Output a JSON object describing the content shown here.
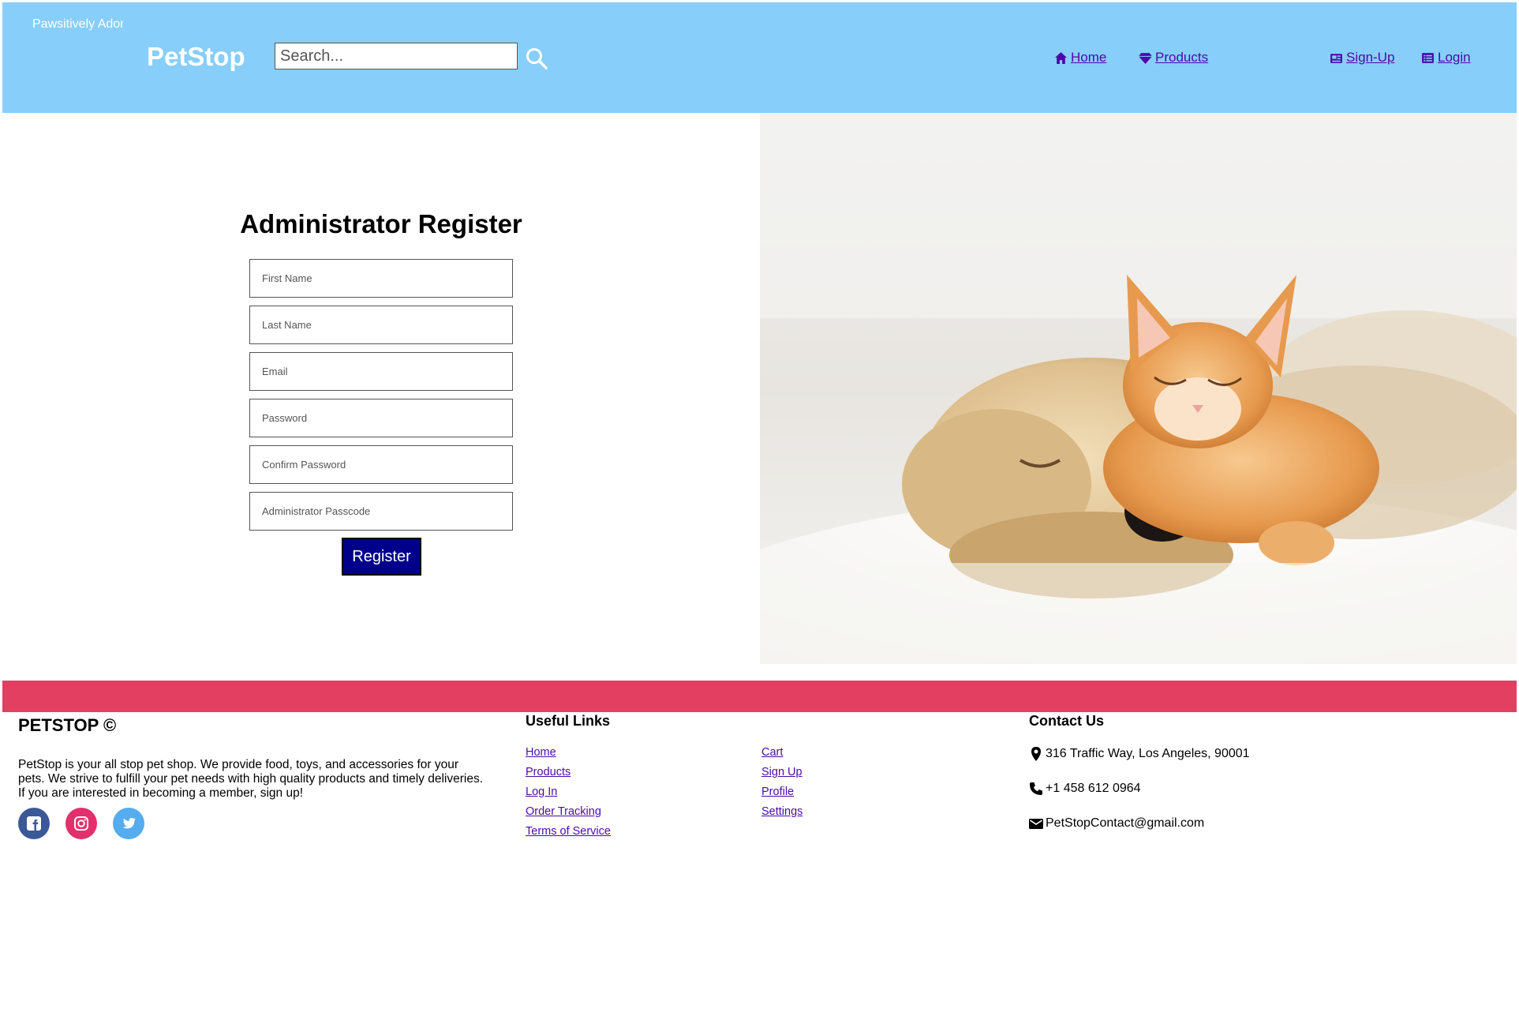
{
  "header": {
    "marquee_text": "Pawsitively Adorable",
    "brand": "PetStop",
    "search_placeholder": "Search...",
    "nav": {
      "home": "Home",
      "products": "Products",
      "signup": "Sign-Up",
      "login": "Login"
    }
  },
  "form": {
    "title": "Administrator Register",
    "fields": {
      "first_name": "First Name",
      "last_name": "Last Name",
      "email": "Email",
      "password": "Password",
      "confirm_password": "Confirm Password",
      "passcode": "Administrator Passcode"
    },
    "submit_label": "Register"
  },
  "footer": {
    "brand": "PETSTOP ©",
    "description": "PetStop is your all stop pet shop. We provide food, toys, and accessories for your pets. We strive to fulfill your pet needs with high quality products and timely deliveries. If you are interested in becoming a member, sign up!",
    "useful_links_title": "Useful Links",
    "links_col1": [
      "Home",
      "Products",
      "Log In",
      "Order Tracking",
      "Terms of Service"
    ],
    "links_col2": [
      "Cart",
      "Sign Up",
      "Profile",
      "Settings"
    ],
    "contact_title": "Contact Us",
    "address": "316 Traffic Way, Los Angeles, 90001",
    "phone": "+1 458 612 0964",
    "email": "PetStopContact@gmail.com"
  },
  "colors": {
    "header_bg": "#87cefa",
    "footer_strip": "#e23f61",
    "link": "#4b0aa8",
    "button": "#00008b",
    "facebook": "#3b5998",
    "instagram": "#e1306c",
    "twitter": "#55acee"
  },
  "icons": [
    "search-icon",
    "home-icon",
    "gem-icon",
    "signup-icon",
    "login-icon",
    "facebook-icon",
    "instagram-icon",
    "twitter-icon",
    "map-pin-icon",
    "phone-icon",
    "mail-icon"
  ]
}
